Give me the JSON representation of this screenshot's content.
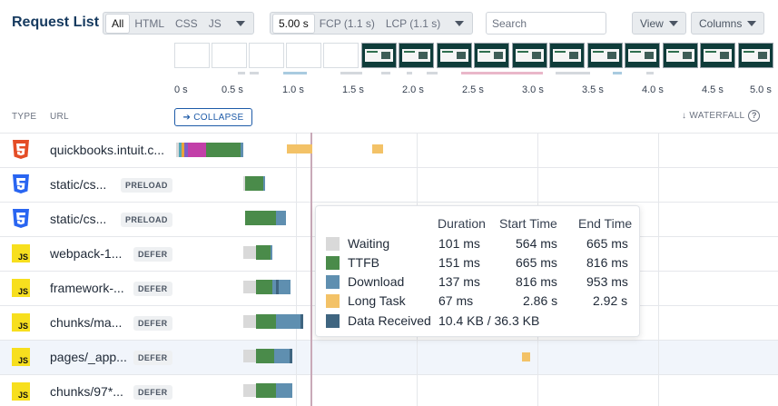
{
  "toolbar": {
    "title": "Request List",
    "filters": [
      "All",
      "HTML",
      "CSS",
      "JS"
    ],
    "filter_active": "All",
    "time_range": "5.00 s",
    "fcp": "FCP (1.1 s)",
    "lcp": "LCP (1.1 s)",
    "search_placeholder": "Search",
    "view_label": "View",
    "columns_label": "Columns"
  },
  "timeline": {
    "axis_labels": [
      "0 s",
      "0.5 s",
      "1.0 s",
      "1.5 s",
      "2.0 s",
      "2.5 s",
      "3.0 s",
      "3.5 s",
      "4.0 s",
      "4.5 s",
      "5.0 s"
    ],
    "filmstrip_blank_frames": 5,
    "filmstrip_screenshot_frames": 11
  },
  "columns": {
    "type": "TYPE",
    "url": "URL",
    "collapse": "➔ COLLAPSE",
    "waterfall": "↓ WATERFALL",
    "help": "?"
  },
  "requests": [
    {
      "type_icon": "html5-icon",
      "url": "quickbooks.intuit.c...",
      "badge": ""
    },
    {
      "type_icon": "css3-icon",
      "url": "static/cs...",
      "badge": "PRELOAD"
    },
    {
      "type_icon": "css3-icon",
      "url": "static/cs...",
      "badge": "PRELOAD"
    },
    {
      "type_icon": "js-icon",
      "url": "webpack-1...",
      "badge": "DEFER",
      "js": "JS"
    },
    {
      "type_icon": "js-icon",
      "url": "framework-...",
      "badge": "DEFER",
      "js": "JS"
    },
    {
      "type_icon": "js-icon",
      "url": "chunks/ma...",
      "badge": "DEFER",
      "js": "JS"
    },
    {
      "type_icon": "js-icon",
      "url": "pages/_app...",
      "badge": "DEFER",
      "js": "JS"
    },
    {
      "type_icon": "js-icon",
      "url": "chunks/97*...",
      "badge": "DEFER",
      "js": "JS"
    }
  ],
  "tooltip": {
    "headers": {
      "duration": "Duration",
      "start": "Start Time",
      "end": "End Time"
    },
    "rows": [
      {
        "label": "Waiting",
        "color": "#d9d9d9",
        "duration": "101 ms",
        "start": "564 ms",
        "end": "665 ms"
      },
      {
        "label": "TTFB",
        "color": "#4a8b4a",
        "duration": "151 ms",
        "start": "665 ms",
        "end": "816 ms"
      },
      {
        "label": "Download",
        "color": "#5f8fb0",
        "duration": "137 ms",
        "start": "816 ms",
        "end": "953 ms"
      },
      {
        "label": "Long Task",
        "color": "#f3c267",
        "duration": "67 ms",
        "start": "2.86 s",
        "end": "2.92 s"
      },
      {
        "label": "Data Received",
        "color": "#3f6580",
        "duration": "10.4 KB / 36.3 KB",
        "start": "",
        "end": ""
      }
    ]
  }
}
